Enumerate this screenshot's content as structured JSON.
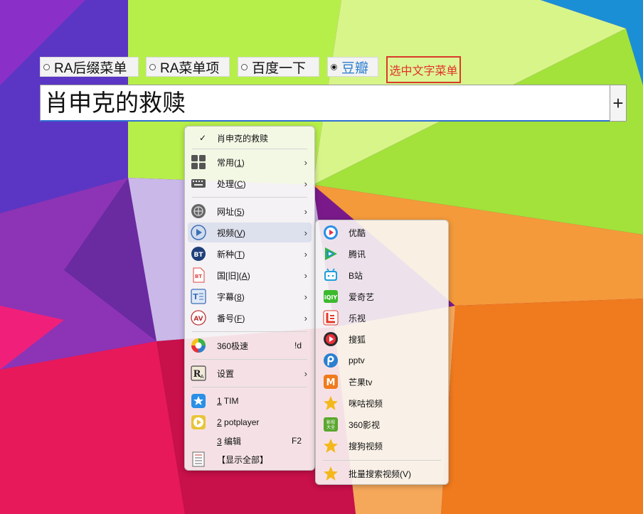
{
  "tabs": [
    {
      "label": "RA后缀菜单",
      "checked": false
    },
    {
      "label": "RA菜单项",
      "checked": false
    },
    {
      "label": "百度一下",
      "checked": false
    },
    {
      "label": "豆瓣",
      "checked": true
    }
  ],
  "select_menu_tag": "选中文字菜单",
  "search": {
    "value": "肖申克的救赎"
  },
  "add_button": "+",
  "main_menu": {
    "header": {
      "label": "肖申克的救赎",
      "check": "✓"
    },
    "items": [
      {
        "pre": "常用(",
        "key": "1",
        "post": ")",
        "icon": "grid-icon",
        "arrow": "›"
      },
      {
        "pre": "处理(",
        "key": "C",
        "post": ")",
        "icon": "keyboard-icon",
        "arrow": "›"
      },
      {
        "pre": "网址(",
        "key": "5",
        "post": ")",
        "icon": "globe-icon",
        "arrow": "›"
      },
      {
        "pre": "视频(",
        "key": "V",
        "post": ")",
        "icon": "video-icon",
        "arrow": "›"
      },
      {
        "pre": "新种(",
        "key": "T",
        "post": ")",
        "icon": "bt-icon",
        "arrow": "›"
      },
      {
        "pre": "国[旧](",
        "key": "A",
        "post": ")",
        "icon": "bt-file-icon",
        "arrow": "›"
      },
      {
        "pre": "字幕(",
        "key": "8",
        "post": ")",
        "icon": "subtitle-icon",
        "arrow": "›"
      },
      {
        "pre": "番号(",
        "key": "F",
        "post": ")",
        "icon": "av-icon",
        "arrow": "›"
      },
      {
        "pre": "360极速",
        "key": "",
        "post": "",
        "icon": "browser-360-icon",
        "shortcut": "!d"
      },
      {
        "pre": "设置",
        "key": "",
        "post": "",
        "icon": "ra-settings-icon",
        "arrow": "›"
      },
      {
        "pre": "",
        "key": "1",
        "post": " TIM",
        "icon": "tim-icon"
      },
      {
        "pre": "",
        "key": "2",
        "post": " potplayer",
        "icon": "potplayer-icon"
      },
      {
        "pre": "",
        "key": "3",
        "post": " 编辑",
        "icon": "",
        "shortcut": "F2"
      },
      {
        "pre": "【显示全部】",
        "key": "",
        "post": "",
        "icon": "list-icon"
      }
    ]
  },
  "sub_menu": {
    "items": [
      {
        "label": "优酷",
        "icon": "youku-icon"
      },
      {
        "label": "腾讯",
        "icon": "tencent-video-icon"
      },
      {
        "label": "B站",
        "icon": "bilibili-icon"
      },
      {
        "label": "爱奇艺",
        "icon": "iqiyi-icon"
      },
      {
        "label": "乐视",
        "icon": "letv-icon"
      },
      {
        "label": "搜狐",
        "icon": "sohu-icon"
      },
      {
        "label": "pptv",
        "icon": "pptv-icon"
      },
      {
        "label": "芒果tv",
        "icon": "mango-icon"
      },
      {
        "label": "咪咕视频",
        "icon": "star-icon"
      },
      {
        "label": "360影视",
        "icon": "video-360-icon"
      },
      {
        "label": "搜狗视频",
        "icon": "star-icon"
      },
      {
        "label": "批量搜索视频(V)",
        "icon": "star-icon"
      }
    ]
  },
  "colors": {
    "accent": "#2f7fd0",
    "tag_red": "#e0322a"
  }
}
